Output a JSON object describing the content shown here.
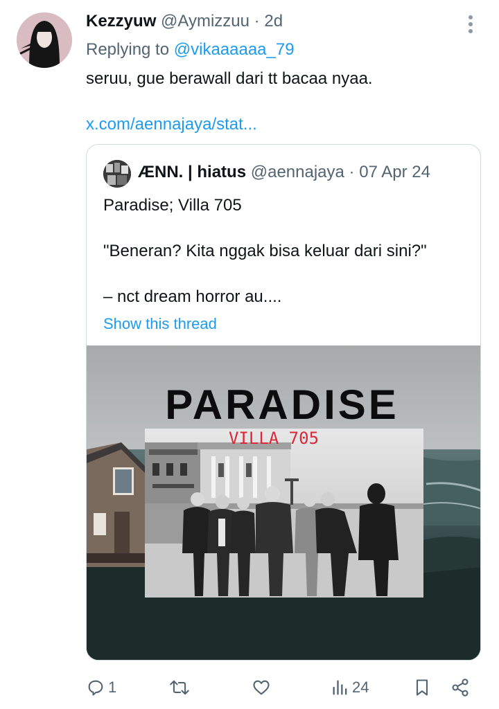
{
  "tweet": {
    "author_name": "Kezzyuw",
    "author_handle": "@Aymizzuu",
    "separator": "·",
    "time": "2d",
    "replying_prefix": "Replying to",
    "replying_handle": "@vikaaaaaa_79",
    "text": "seruu, gue berawall dari tt bacaa nyaa.",
    "link": "x.com/aennajaya/stat..."
  },
  "quote": {
    "author_name": "ÆNN. | hiatus",
    "author_handle": "@aennajaya",
    "separator": "·",
    "date": "07 Apr 24",
    "lines": [
      "Paradise; Villa 705",
      "\"Beneran? Kita nggak bisa keluar dari sini?\"",
      "– nct dream horror au...."
    ],
    "show_thread": "Show this thread",
    "media": {
      "title": "PARADISE",
      "subtitle": "VILLA 705"
    }
  },
  "actions": {
    "reply_count": "1",
    "retweet_count": "",
    "like_count": "",
    "views_count": "24"
  },
  "colors": {
    "accent": "#1d9bf0",
    "muted": "#536471",
    "text": "#0f1419",
    "border": "#cfd9de",
    "poster_red": "#d9283a"
  }
}
